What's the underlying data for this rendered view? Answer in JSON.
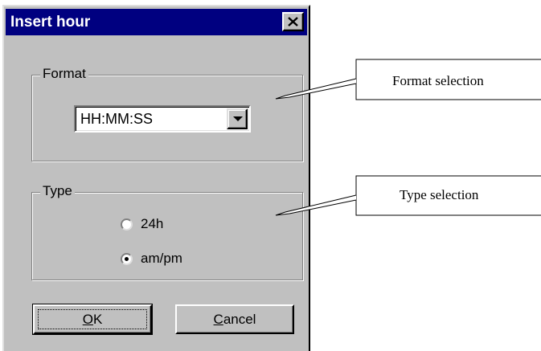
{
  "dialog": {
    "title": "Insert hour",
    "close_icon": "close-icon",
    "format_group": {
      "legend": "Format",
      "selected_format": "HH:MM:SS"
    },
    "type_group": {
      "legend": "Type",
      "options": [
        {
          "label": "24h",
          "checked": false
        },
        {
          "label": "am/pm",
          "checked": true
        }
      ]
    },
    "buttons": {
      "ok_mnemonic": "O",
      "ok_rest": "K",
      "cancel_mnemonic": "C",
      "cancel_rest": "ancel"
    }
  },
  "callouts": {
    "format": "Format selection",
    "type": "Type selection"
  },
  "colors": {
    "titlebar": "#000080",
    "dialog_face": "#c0c0c0",
    "title_text": "#ffffff"
  }
}
